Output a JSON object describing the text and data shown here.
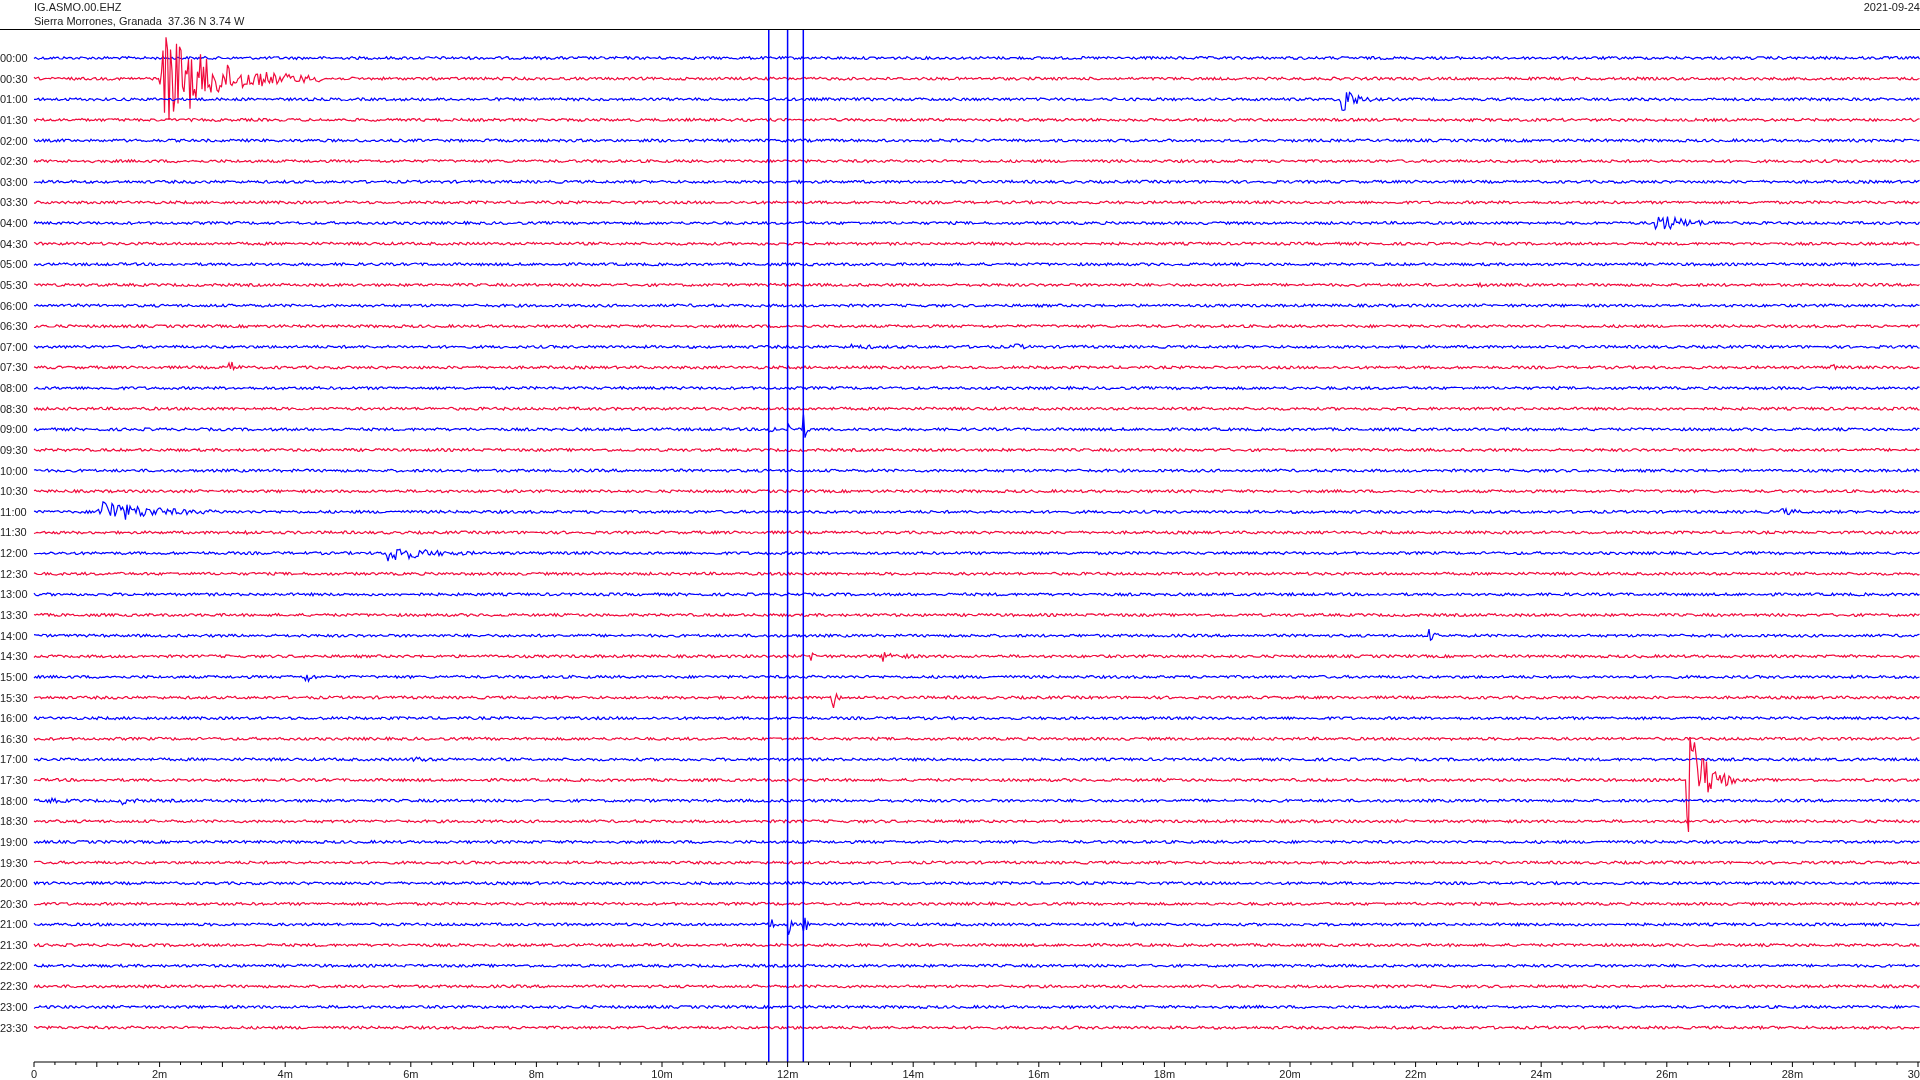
{
  "header": {
    "channel": "IG.ASMO.00.EHZ",
    "station": "Sierra Morrones, Granada  37.36 N 3.74 W",
    "date": "2021-09-24"
  },
  "traces": [
    {
      "label": "00:00",
      "color": "#0000ff"
    },
    {
      "label": "00:30",
      "color": "#f00a3c"
    },
    {
      "label": "01:00",
      "color": "#0000ff"
    },
    {
      "label": "01:30",
      "color": "#f00a3c"
    },
    {
      "label": "02:00",
      "color": "#0000ff"
    },
    {
      "label": "02:30",
      "color": "#f00a3c"
    },
    {
      "label": "03:00",
      "color": "#0000ff"
    },
    {
      "label": "03:30",
      "color": "#f00a3c"
    },
    {
      "label": "04:00",
      "color": "#0000ff"
    },
    {
      "label": "04:30",
      "color": "#f00a3c"
    },
    {
      "label": "05:00",
      "color": "#0000ff"
    },
    {
      "label": "05:30",
      "color": "#f00a3c"
    },
    {
      "label": "06:00",
      "color": "#0000ff"
    },
    {
      "label": "06:30",
      "color": "#f00a3c"
    },
    {
      "label": "07:00",
      "color": "#0000ff"
    },
    {
      "label": "07:30",
      "color": "#f00a3c"
    },
    {
      "label": "08:00",
      "color": "#0000ff"
    },
    {
      "label": "08:30",
      "color": "#f00a3c"
    },
    {
      "label": "09:00",
      "color": "#0000ff"
    },
    {
      "label": "09:30",
      "color": "#f00a3c"
    },
    {
      "label": "10:00",
      "color": "#0000ff"
    },
    {
      "label": "10:30",
      "color": "#f00a3c"
    },
    {
      "label": "11:00",
      "color": "#0000ff"
    },
    {
      "label": "11:30",
      "color": "#f00a3c"
    },
    {
      "label": "12:00",
      "color": "#0000ff"
    },
    {
      "label": "12:30",
      "color": "#f00a3c"
    },
    {
      "label": "13:00",
      "color": "#0000ff"
    },
    {
      "label": "13:30",
      "color": "#f00a3c"
    },
    {
      "label": "14:00",
      "color": "#0000ff"
    },
    {
      "label": "14:30",
      "color": "#f00a3c"
    },
    {
      "label": "15:00",
      "color": "#0000ff"
    },
    {
      "label": "15:30",
      "color": "#f00a3c"
    },
    {
      "label": "16:00",
      "color": "#0000ff"
    },
    {
      "label": "16:30",
      "color": "#f00a3c"
    },
    {
      "label": "17:00",
      "color": "#0000ff"
    },
    {
      "label": "17:30",
      "color": "#f00a3c"
    },
    {
      "label": "18:00",
      "color": "#0000ff"
    },
    {
      "label": "18:30",
      "color": "#f00a3c"
    },
    {
      "label": "19:00",
      "color": "#0000ff"
    },
    {
      "label": "19:30",
      "color": "#f00a3c"
    },
    {
      "label": "20:00",
      "color": "#0000ff"
    },
    {
      "label": "20:30",
      "color": "#f00a3c"
    },
    {
      "label": "21:00",
      "color": "#0000ff"
    },
    {
      "label": "21:30",
      "color": "#f00a3c"
    },
    {
      "label": "22:00",
      "color": "#0000ff"
    },
    {
      "label": "22:30",
      "color": "#f00a3c"
    },
    {
      "label": "23:00",
      "color": "#0000ff"
    },
    {
      "label": "23:30",
      "color": "#f00a3c"
    }
  ],
  "x_axis": {
    "ticks": [
      "0",
      "2m",
      "4m",
      "6m",
      "8m",
      "10m",
      "12m",
      "14m",
      "16m",
      "18m",
      "20m",
      "22m",
      "24m",
      "26m",
      "28m",
      "30"
    ]
  }
}
